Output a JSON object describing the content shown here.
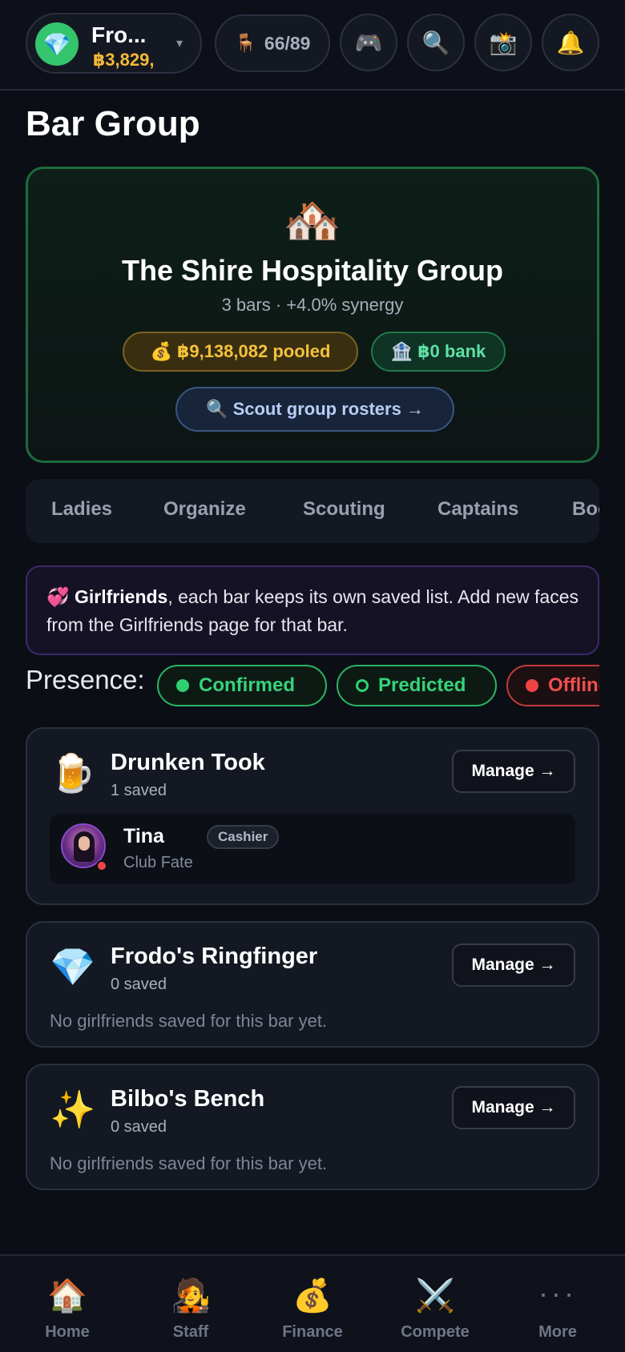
{
  "header": {
    "account_name": "Fro...",
    "account_money": "฿3,829,",
    "seats_icon": "🪑",
    "seats": "66/89",
    "icons": [
      "gamepad-icon",
      "search-icon",
      "camera-icon",
      "bell-icon"
    ],
    "gem_icon": "💎",
    "caret": "▾",
    "gamepad": "🎮",
    "search": "🔍",
    "camera": "📸",
    "bell": "🔔"
  },
  "page": {
    "title": "Bar Group"
  },
  "group": {
    "icon": "🏘️",
    "name": "The Shire Hospitality Group",
    "subtitle": "3 bars · +4.0% synergy",
    "pooled": "💰 ฿9,138,082 pooled",
    "bank": "🏦 ฿0 bank",
    "scout_label": "🔍 Scout group rosters →"
  },
  "tabs": [
    "Ladies",
    "Organize",
    "Scouting",
    "Captains",
    "Boo"
  ],
  "info": {
    "icon": "💞",
    "bold": "Girlfriends",
    "text": ", each bar keeps its own saved list. Add new faces from the Girlfriends page for that bar."
  },
  "presence": {
    "label": "Presence:",
    "confirmed": "Confirmed",
    "predicted": "Predicted",
    "offline": "Offline"
  },
  "bars": [
    {
      "icon": "🍺",
      "name": "Drunken Took",
      "count": "1 saved",
      "manage": "Manage →",
      "girlfriend": {
        "name": "Tina",
        "role": "Cashier",
        "club": "Club Fate"
      }
    },
    {
      "icon": "💎",
      "name": "Frodo's Ringfinger",
      "count": "0 saved",
      "manage": "Manage →",
      "empty": "No girlfriends saved for this bar yet."
    },
    {
      "icon": "✨",
      "name": "Bilbo's Bench",
      "count": "0 saved",
      "manage": "Manage →",
      "empty": "No girlfriends saved for this bar yet."
    }
  ],
  "bottom_nav": [
    {
      "icon": "🏠",
      "label": "Home"
    },
    {
      "icon": "🧑‍🎤",
      "label": "Staff"
    },
    {
      "icon": "💰",
      "label": "Finance"
    },
    {
      "icon": "⚔️",
      "label": "Compete"
    },
    {
      "icon": "···",
      "label": "More"
    }
  ]
}
